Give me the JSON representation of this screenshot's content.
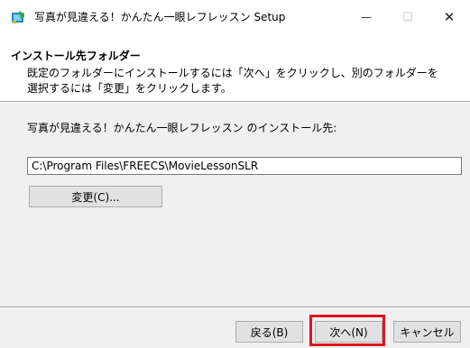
{
  "window": {
    "title": "写真が見違える！かんたん一眼レフレッスン Setup",
    "minimize_glyph": "—",
    "maximize_glyph": "☐",
    "close_glyph": "✕"
  },
  "header": {
    "title": "インストール先フォルダー",
    "description_line1": "既定のフォルダーにインストールするには「次へ」をクリックし、別のフォルダーを",
    "description_line2": "選択するには「変更」をクリックします。"
  },
  "body": {
    "prompt": "写真が見違える！かんたん一眼レフレッスン のインストール先:",
    "install_path": "C:\\Program Files\\FREECS\\MovieLessonSLR",
    "change_button": "変更(C)..."
  },
  "footer": {
    "back_button": "戻る(B)",
    "next_button": "次へ(N)",
    "cancel_button": "キャンセル"
  },
  "colors": {
    "highlight": "#e0141e",
    "background": "#f0f0f0"
  },
  "icons": {
    "app": "installer-icon"
  }
}
